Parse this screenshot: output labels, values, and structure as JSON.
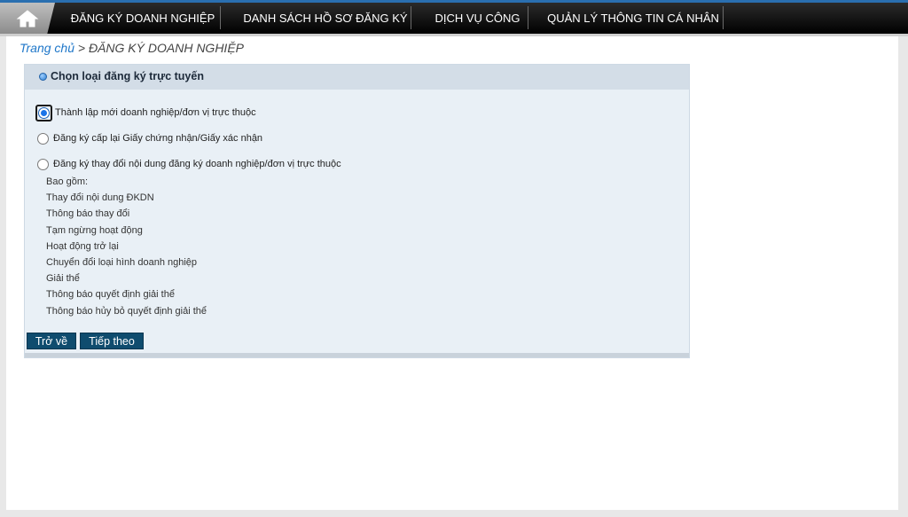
{
  "nav": {
    "items": [
      {
        "label": "ĐĂNG KÝ DOANH NGHIỆP"
      },
      {
        "label": "DANH SÁCH HỒ SƠ ĐĂNG KÝ"
      },
      {
        "label": "DỊCH VỤ CÔNG"
      },
      {
        "label": "QUẢN LÝ THÔNG TIN CÁ NHÂN"
      }
    ]
  },
  "breadcrumb": {
    "home": "Trang chủ",
    "separator": " > ",
    "current": "ĐĂNG KÝ DOANH NGHIỆP"
  },
  "panel": {
    "title": "Chọn loại đăng ký trực tuyến",
    "options": [
      {
        "label": "Thành lập mới doanh nghiệp/đơn vị trực thuộc",
        "checked": true
      },
      {
        "label": "Đăng ký cấp lại Giấy chứng nhận/Giấy xác nhận",
        "checked": false
      },
      {
        "label": "Đăng ký thay đổi nội dung đăng ký doanh nghiệp/đơn vị trực thuộc",
        "checked": false
      }
    ],
    "includes_title": "Bao gồm:",
    "includes": [
      "Thay đổi nội dung ĐKDN",
      "Thông báo thay đổi",
      "Tạm ngừng hoạt động",
      "Hoạt động trở lại",
      "Chuyển đổi loại hình doanh nghiệp",
      "Giải thể",
      "Thông báo quyết định giải thể",
      "Thông báo hủy bỏ quyết định giải thể"
    ],
    "back_label": "Trở về",
    "next_label": "Tiếp theo"
  },
  "colors": {
    "nav_bg": "#000000",
    "accent": "#2a6fb0",
    "button_bg": "#0f4c6e",
    "panel_bg": "#e9f0f6"
  }
}
